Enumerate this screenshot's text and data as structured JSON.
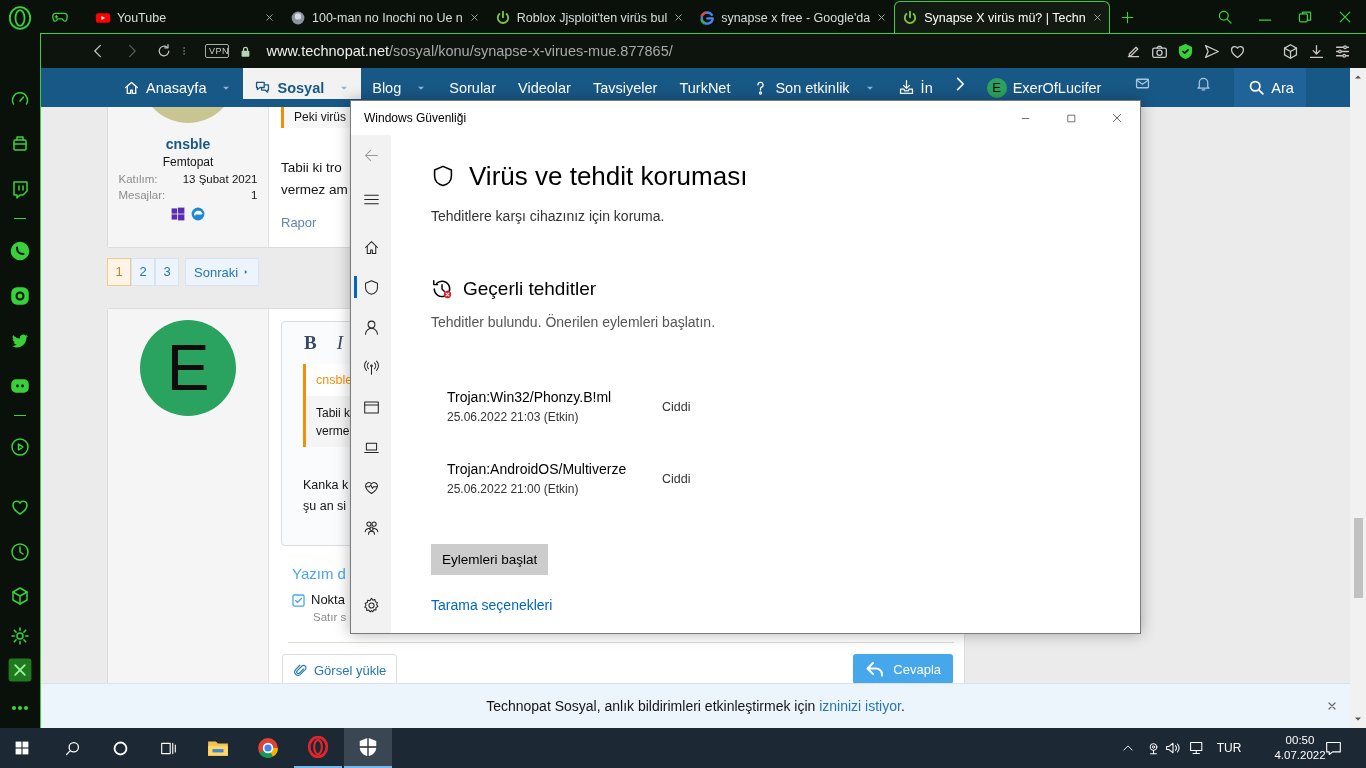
{
  "browser": {
    "tabs": [
      {
        "kind": "youtube",
        "title": "YouTube",
        "selected": false
      },
      {
        "kind": "image",
        "title": "100-man no Inochi no Ue n",
        "selected": false
      },
      {
        "kind": "power",
        "title": "Roblox Jjsploit'ten virüs bul",
        "selected": false
      },
      {
        "kind": "google",
        "title": "synapse x free - Google'da",
        "selected": false
      },
      {
        "kind": "power",
        "title": "Synapse X virüs mü? | Techn",
        "selected": true
      }
    ],
    "address": {
      "vpn": "VPN",
      "host": "www.technopat.net",
      "path": "/sosyal/konu/synapse-x-virues-mue.877865/"
    }
  },
  "site_nav": {
    "items": [
      {
        "kind": "home",
        "label": "Anasayfa",
        "dropdown": true,
        "selected": false
      },
      {
        "kind": "chat",
        "label": "Sosyal",
        "dropdown": true,
        "selected": true
      },
      {
        "kind": "plain",
        "label": "Blog",
        "dropdown": true,
        "selected": false
      },
      {
        "kind": "plain",
        "label": "Sorular",
        "dropdown": false,
        "selected": false
      },
      {
        "kind": "plain",
        "label": "Videolar",
        "dropdown": false,
        "selected": false
      },
      {
        "kind": "plain",
        "label": "Tavsiyeler",
        "dropdown": false,
        "selected": false
      },
      {
        "kind": "plain",
        "label": "TurkNet",
        "dropdown": false,
        "selected": false
      },
      {
        "kind": "question",
        "label": "Son etkinlik",
        "dropdown": true,
        "selected": false
      },
      {
        "kind": "download",
        "label": "İn",
        "dropdown": false,
        "selected": false
      }
    ],
    "user": {
      "initial": "E",
      "name": "ExerOfLucifer"
    },
    "search": "Ara"
  },
  "post": {
    "quote": "Peki virüs",
    "author": "cnsble",
    "user_title": "Femtopat",
    "stats": [
      {
        "label": "Katılım:",
        "value": "13 Şubat 2021"
      },
      {
        "label": "Mesajlar:",
        "value": "1"
      }
    ],
    "body": [
      "Tabii ki tro",
      "vermez am"
    ],
    "report": "Rapor"
  },
  "pagination": {
    "pages": [
      {
        "label": "1",
        "selected": true
      },
      {
        "label": "2",
        "selected": false
      },
      {
        "label": "3",
        "selected": false
      }
    ],
    "next": "Sonraki"
  },
  "reply": {
    "avatar": "E",
    "toolbar": [
      {
        "kind": "bold",
        "label": "B"
      },
      {
        "kind": "italic",
        "label": "I"
      }
    ],
    "quote_author": "cnsble",
    "quote_lines": [
      "Tabii k",
      "verme"
    ],
    "text_lines": [
      "Kanka k",
      "şu an si"
    ],
    "options_title": "Yazım d",
    "option": {
      "label": "Nokta",
      "hint": "Satır s",
      "checked": true
    },
    "upload": "Görsel yükle",
    "submit": "Cevapla"
  },
  "notification": {
    "text": "Technopat Sosyal, anlık bildirimleri etkinleştirmek için ",
    "link": "izninizi istiyor",
    "end": "."
  },
  "security": {
    "title": "Windows Güvenliği",
    "nav": [
      {
        "kind": "back",
        "selected": false
      },
      {
        "kind": "menu",
        "selected": false
      },
      {
        "kind": "home",
        "selected": false
      },
      {
        "kind": "shield",
        "selected": true
      },
      {
        "kind": "person",
        "selected": false
      },
      {
        "kind": "antenna",
        "selected": false
      },
      {
        "kind": "window",
        "selected": false
      },
      {
        "kind": "laptop",
        "selected": false
      },
      {
        "kind": "heart",
        "selected": false
      },
      {
        "kind": "family",
        "selected": false
      },
      {
        "kind": "gear",
        "selected": false
      }
    ],
    "heading": "Virüs ve tehdit koruması",
    "subtitle": "Tehditlere karşı cihazınız için koruma.",
    "section_title": "Geçerli tehditler",
    "section_text": "Tehditler bulundu. Önerilen eylemleri başlatın.",
    "threats": [
      {
        "name": "Trojan:Win32/Phonzy.B!ml",
        "date": "25.06.2022 21:03 (Etkin)",
        "severity": "Ciddi"
      },
      {
        "name": "Trojan:AndroidOS/Multiverze",
        "date": "25.06.2022 21:00 (Etkin)",
        "severity": "Ciddi"
      }
    ],
    "action": "Eylemleri başlat",
    "link": "Tarama seçenekleri"
  },
  "taskbar": {
    "apps": [
      {
        "kind": "folder",
        "running": false,
        "selected": false
      },
      {
        "kind": "chrome",
        "running": false,
        "selected": false
      },
      {
        "kind": "opera",
        "running": true,
        "selected": false
      },
      {
        "kind": "shield",
        "running": true,
        "selected": true
      }
    ],
    "language": "TUR",
    "time": "00:50",
    "date": "4.07.2022"
  }
}
